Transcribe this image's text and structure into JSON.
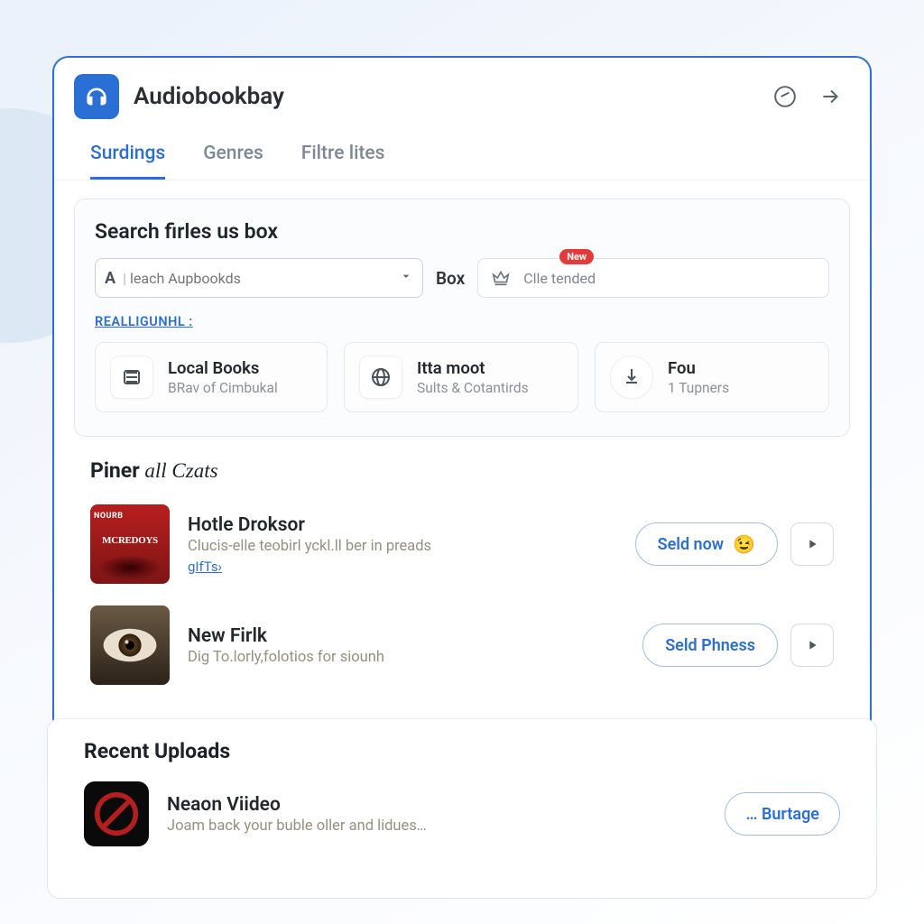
{
  "app": {
    "title": "Audiobookbay"
  },
  "tabs": [
    {
      "label": "Surdings",
      "active": true
    },
    {
      "label": "Genres",
      "active": false
    },
    {
      "label": "Filtre lites",
      "active": false
    }
  ],
  "search": {
    "title": "Search firles us box",
    "placeholder": "leach Aupbookds",
    "box_label": "Box",
    "filter_text": "Clle tended",
    "badge": "New",
    "link": "REALLIGUNHL :"
  },
  "cards": [
    {
      "title": "Local Books",
      "sub": "BRav of Cimbukal",
      "icon": "list"
    },
    {
      "title": "Itta moot",
      "sub": "Sults & Cotantirds",
      "icon": "globe"
    },
    {
      "title": "Fou",
      "sub": "1 Tupners",
      "icon": "download"
    }
  ],
  "section_piner": {
    "title_a": "Piner ",
    "title_b": "all Czats",
    "items": [
      {
        "title": "Hotle Droksor",
        "sub": "Clucis-elle teobirl yckl.ll ber in preads",
        "link": "gIfTs›",
        "button": "Seld now",
        "emoji": "😉",
        "thumb": {
          "band": "NOURB",
          "mc": "MCREDOYS"
        }
      },
      {
        "title": "New Firlk",
        "sub": "Dig To.lorly,folotios for siounh",
        "button": "Seld Phness"
      }
    ]
  },
  "section_recent": {
    "title": "Recent Uploads",
    "items": [
      {
        "title": "Neaon Viideo",
        "sub": "Joam back your buble oller and lidues…",
        "button": "… Burtage"
      }
    ]
  }
}
